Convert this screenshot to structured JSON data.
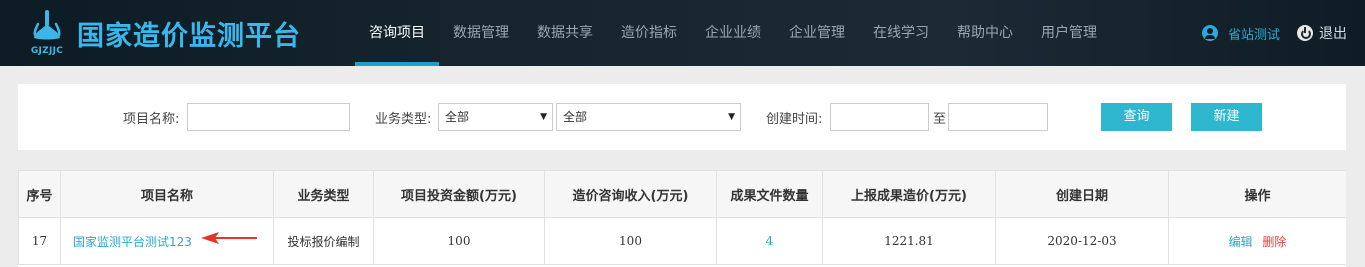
{
  "header": {
    "logo_sub": "GJZJJC",
    "title": "国家造价监测平台",
    "nav": [
      {
        "label": "咨询项目",
        "active": true
      },
      {
        "label": "数据管理",
        "active": false
      },
      {
        "label": "数据共享",
        "active": false
      },
      {
        "label": "造价指标",
        "active": false
      },
      {
        "label": "企业业绩",
        "active": false
      },
      {
        "label": "企业管理",
        "active": false
      },
      {
        "label": "在线学习",
        "active": false
      },
      {
        "label": "帮助中心",
        "active": false
      },
      {
        "label": "用户管理",
        "active": false
      }
    ],
    "user": "省站测试",
    "logout": "退出",
    "accent": "#38b8ec"
  },
  "filter": {
    "project_name_label": "项目名称:",
    "project_name_value": "",
    "biz_type_label": "业务类型:",
    "biz_type_1": "全部",
    "biz_type_2": "全部",
    "date_label": "创建时间:",
    "date_from": "",
    "date_to_sep": "至",
    "date_to": "",
    "search_button": "查询",
    "new_button": "新建"
  },
  "table": {
    "headers": [
      "序号",
      "项目名称",
      "业务类型",
      "项目投资金额(万元)",
      "造价咨询收入(万元)",
      "成果文件数量",
      "上报成果造价(万元)",
      "创建日期",
      "操作"
    ],
    "rows": [
      {
        "index": "17",
        "name": "国家监测平台测试123",
        "biz_type": "投标报价编制",
        "investment": "100",
        "income": "100",
        "file_count": "4",
        "reported_cost": "1221.81",
        "created": "2020-12-03",
        "edit": "编辑",
        "delete": "删除"
      }
    ]
  }
}
